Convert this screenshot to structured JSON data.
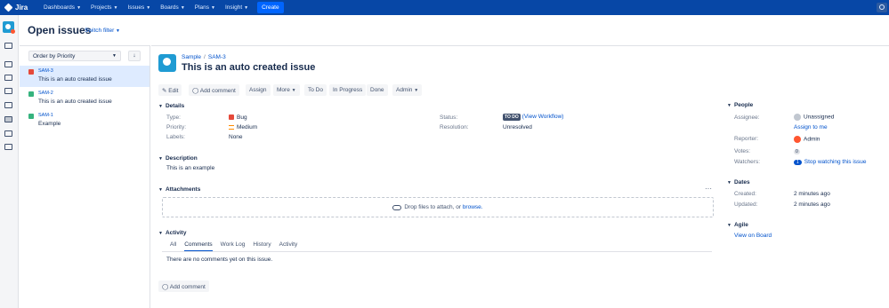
{
  "nav": {
    "brand": "Jira",
    "items": [
      "Dashboards",
      "Projects",
      "Issues",
      "Boards",
      "Plans",
      "Insight"
    ],
    "create": "Create"
  },
  "page": {
    "title": "Open issues",
    "switch_filter": "Switch filter"
  },
  "list": {
    "order_by": "Order by Priority",
    "issues": [
      {
        "key": "SAM-3",
        "summary": "This is an auto created issue",
        "type_color": "#e5493a"
      },
      {
        "key": "SAM-2",
        "summary": "This is an auto created issue",
        "type_color": "#36b37e"
      },
      {
        "key": "SAM-1",
        "summary": "Example",
        "type_color": "#36b37e"
      }
    ]
  },
  "issue": {
    "project": "Sample",
    "key": "SAM-3",
    "title": "This is an auto created issue",
    "buttons": {
      "edit": "Edit",
      "comment": "Add comment",
      "assign": "Assign",
      "more": "More",
      "todo": "To Do",
      "in_progress": "In Progress",
      "done": "Done",
      "admin": "Admin"
    },
    "details": {
      "heading": "Details",
      "type_label": "Type:",
      "type": "Bug",
      "priority_label": "Priority:",
      "priority": "Medium",
      "labels_label": "Labels:",
      "labels": "None",
      "status_label": "Status:",
      "status": "TO DO",
      "view_workflow": "(View Workflow)",
      "resolution_label": "Resolution:",
      "resolution": "Unresolved"
    },
    "description": {
      "heading": "Description",
      "text": "This is an example"
    },
    "attachments": {
      "heading": "Attachments",
      "drop_text": "Drop files to attach, or",
      "browse": "browse."
    },
    "activity": {
      "heading": "Activity",
      "tabs": [
        "All",
        "Comments",
        "Work Log",
        "History",
        "Activity"
      ],
      "active_tab": "Comments",
      "empty": "There are no comments yet on this issue.",
      "add_comment": "Add comment"
    }
  },
  "people": {
    "heading": "People",
    "assignee_label": "Assignee:",
    "assignee": "Unassigned",
    "assign_to_me": "Assign to me",
    "reporter_label": "Reporter:",
    "reporter": "Admin",
    "votes_label": "Votes:",
    "votes": "0",
    "watchers_label": "Watchers:",
    "watchers": "1",
    "stop_watching": "Stop watching this issue"
  },
  "dates": {
    "heading": "Dates",
    "created_label": "Created:",
    "created": "2 minutes ago",
    "updated_label": "Updated:",
    "updated": "2 minutes ago"
  },
  "agile": {
    "heading": "Agile",
    "link": "View on Board"
  }
}
